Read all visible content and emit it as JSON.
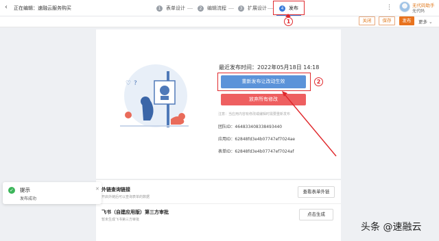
{
  "header": {
    "back_icon": "chevron-left-icon",
    "editing_label": "正在编辑：",
    "app_name": "速融云服务购买",
    "steps": [
      {
        "num": "1",
        "label": "表单设计"
      },
      {
        "num": "2",
        "label": "编辑流程"
      },
      {
        "num": "3",
        "label": "扩展设计"
      },
      {
        "num": "4",
        "label": "发布"
      }
    ],
    "more_icon": "kebab-menu-icon",
    "user": {
      "name": "无代码助手",
      "org": "无代码"
    }
  },
  "toolbar": {
    "close_label": "关闭",
    "save_label": "保存",
    "publish_label": "发布",
    "more_label": "更多",
    "more_icon": "chevron-down-icon"
  },
  "publish": {
    "last_publish": "最近发布时间：2022年05月18日 14:18",
    "republish_label": "重新发布让改动生效",
    "discard_label": "放弃所有修改",
    "notice": "注意：当应用内容有修改或编辑时需要重新发布",
    "team_id": "团队ID：464833408338493440",
    "app_id": "应用ID：62848fd3e4b07747ef7024ae",
    "form_id": "表单ID：62848fd3e4b07747ef7024af"
  },
  "rows": [
    {
      "title": "外链查询链接",
      "sub": "开启外链后可以查询表单的数据",
      "button": "查看表单外链"
    },
    {
      "title": "飞书（自建应用版）第三方审批",
      "sub": "暂未生成飞书第三方审批",
      "button": "点击生成"
    }
  ],
  "toast": {
    "title": "提示",
    "message": "发布成功",
    "close_icon": "close-icon",
    "icon": "check-circle-icon"
  },
  "annotations": {
    "badge1": "1",
    "badge2": "2",
    "color": "#e0282c"
  },
  "watermark": "头条 @速融云",
  "colors": {
    "accent": "#e8731e",
    "primary": "#5b93d9",
    "danger": "#ee5f60",
    "step_active": "#3a7ad9"
  }
}
